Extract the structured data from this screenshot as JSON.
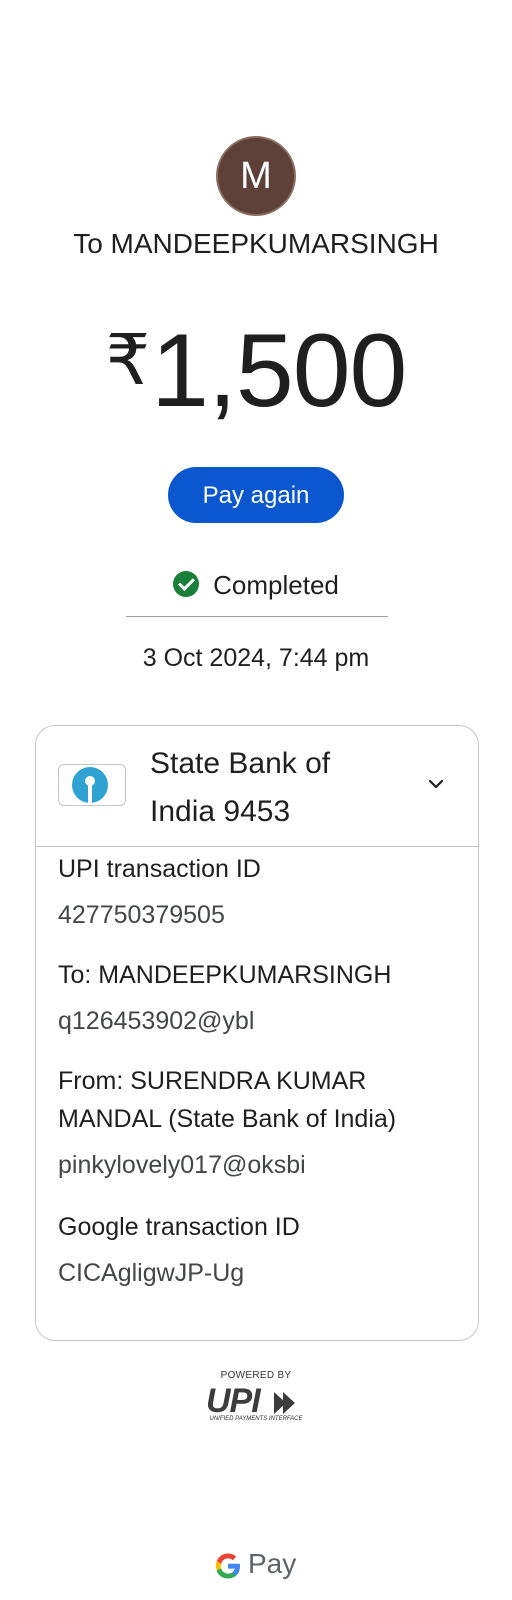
{
  "avatar": {
    "initial": "M",
    "color": "#5d4037"
  },
  "recipient_line": "To MANDEEPKUMARSINGH",
  "amount": {
    "currency": "₹",
    "value": "1,500"
  },
  "pay_again_label": "Pay again",
  "status": {
    "label": "Completed",
    "icon": "check-circle-icon",
    "color": "#188038"
  },
  "datetime": "3 Oct 2024, 7:44 pm",
  "card": {
    "bank_line1": "State Bank of",
    "bank_line2": "India 9453",
    "bank_icon": "sbi-logo-icon",
    "fields": [
      {
        "label": "UPI transaction ID",
        "value": "427750379505"
      },
      {
        "label": "To: MANDEEPKUMARSINGH",
        "value": "q126453902@ybl"
      },
      {
        "label_line1": "From: SURENDRA KUMAR",
        "label_line2": "MANDAL (State Bank of India)",
        "value": "pinkylovely017@oksbi"
      },
      {
        "label": "Google transaction ID",
        "value": "CICAgligwJP-Ug"
      }
    ]
  },
  "footer": {
    "powered_by": "POWERED BY",
    "upi_word": "UPI",
    "upi_sub": "UNIFIED PAYMENTS INTERFACE",
    "gpay_text": "Pay"
  },
  "colors": {
    "primary": "#0b57d0",
    "success": "#188038",
    "sbi_blue": "#2ea3d3"
  }
}
